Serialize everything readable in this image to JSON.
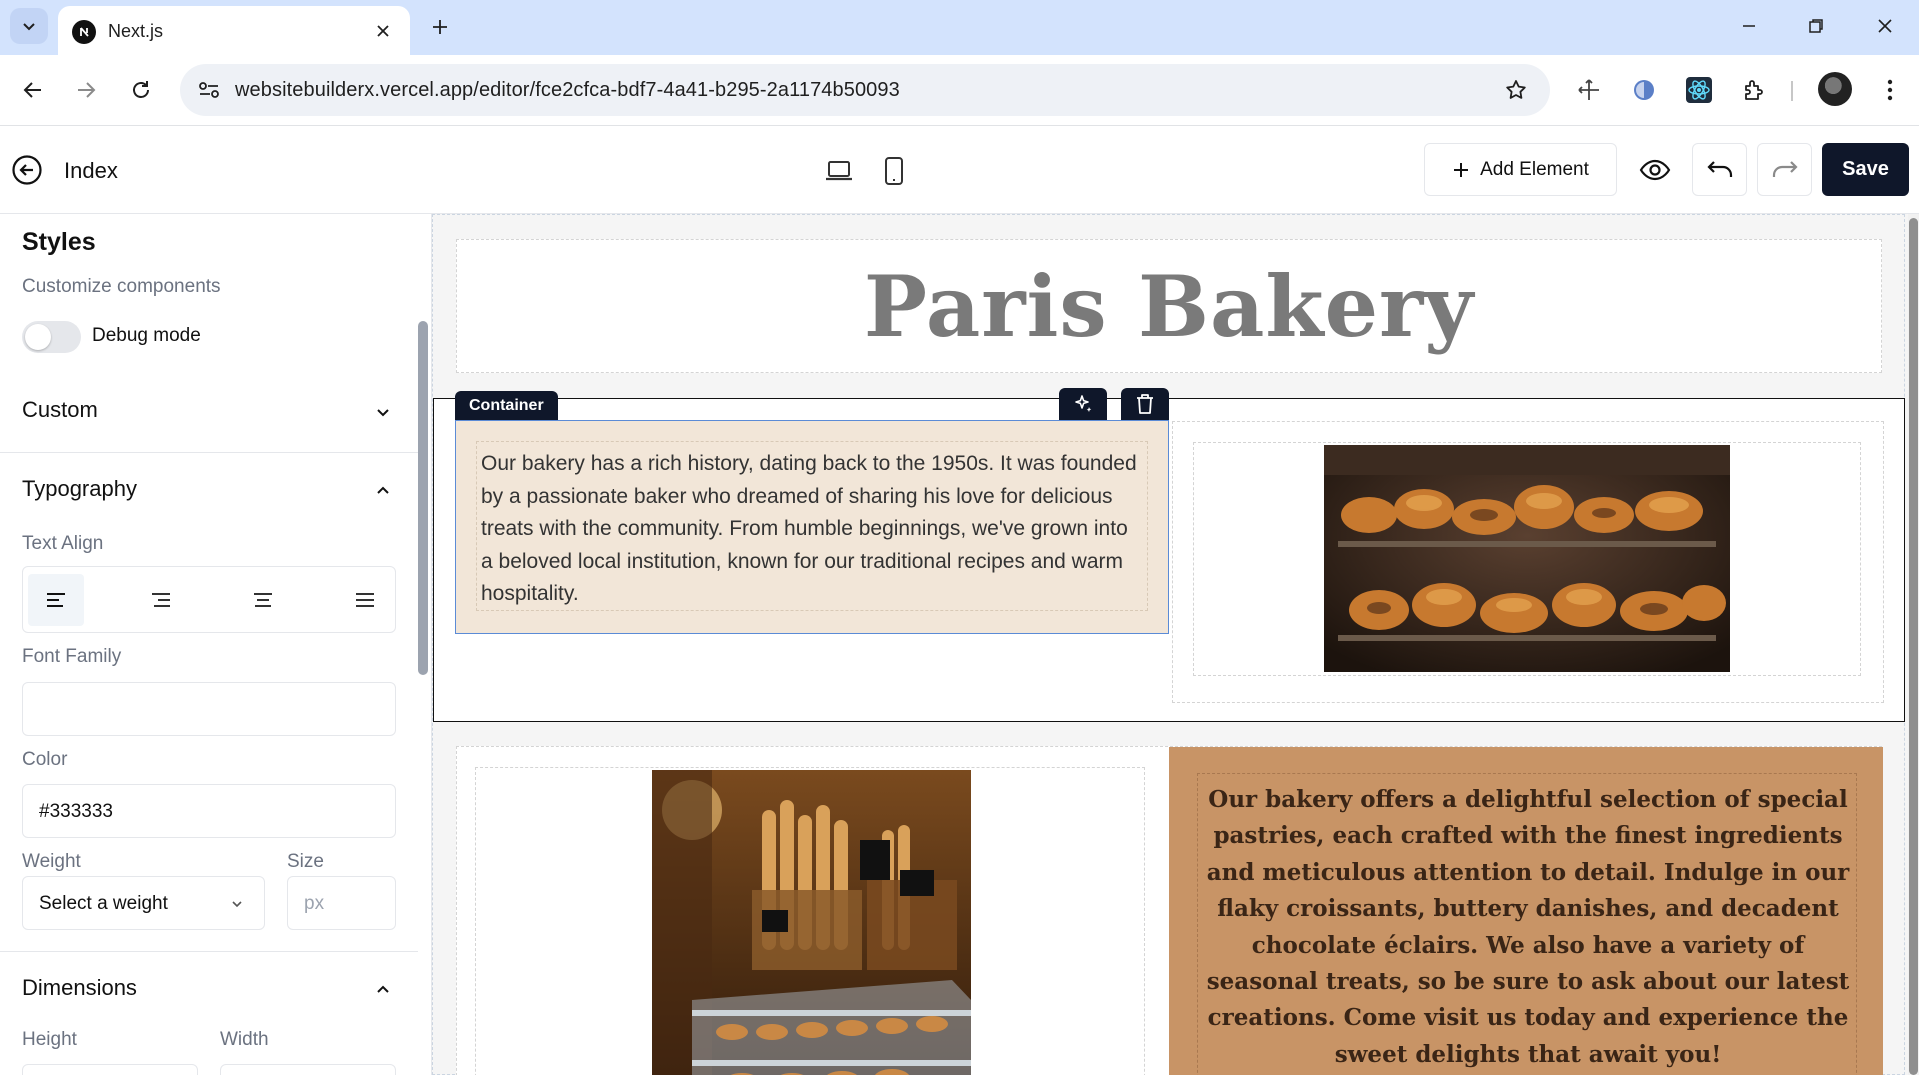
{
  "browser": {
    "tab_title": "Next.js",
    "url": "websitebuilderx.vercel.app/editor/fce2cfca-bdf7-4a41-b295-2a1174b50093",
    "icons": [
      "tab-list-icon",
      "nextjs-favicon",
      "close-icon",
      "plus-icon",
      "minimize-icon",
      "restore-icon",
      "close-window-icon",
      "back-arrow-icon",
      "forward-arrow-icon",
      "reload-icon",
      "site-info-icon",
      "bookmark-star-icon",
      "move-tool-icon",
      "extension-icon",
      "react-devtools-icon",
      "puzzle-extensions-icon",
      "profile-avatar"
    ]
  },
  "editor": {
    "page_name": "Index",
    "add_element_label": "Add Element",
    "save_label": "Save",
    "icons": [
      "back-circle-icon",
      "laptop-icon",
      "mobile-icon",
      "plus-icon",
      "eye-icon",
      "undo-icon",
      "redo-icon"
    ]
  },
  "sidebar": {
    "styles_title": "Styles",
    "styles_subtitle": "Customize components",
    "debug_label": "Debug mode",
    "debug_on": false,
    "custom_title": "Custom",
    "typography_title": "Typography",
    "text_align_label": "Text Align",
    "text_align_options": [
      "left",
      "right",
      "center",
      "justify"
    ],
    "text_align_selected": "left",
    "font_family_label": "Font Family",
    "font_family_value": "",
    "color_label": "Color",
    "color_value": "#333333",
    "weight_label": "Weight",
    "weight_placeholder": "Select a weight",
    "size_label": "Size",
    "size_placeholder": "px",
    "dimensions_title": "Dimensions",
    "height_label": "Height",
    "width_label": "Width"
  },
  "canvas": {
    "hero_title": "Paris Bakery",
    "selected_tag": "Container",
    "history_text": "Our bakery has a rich history, dating back to the 1950s. It was founded by a passionate baker who dreamed of sharing his love for delicious treats with the community. From humble beginnings, we've grown into a beloved local institution, known for our traditional recipes and warm hospitality.",
    "specials_text": "Our bakery offers a delightful selection of special pastries, each crafted with the finest ingredients and meticulous attention to detail. Indulge in our flaky croissants, buttery danishes, and decadent chocolate éclairs. We also have a variety of seasonal treats, so be sure to ask about our latest creations. Come visit us today and experience the sweet delights that await you!",
    "images": [
      "pastry-display-photo",
      "bakery-interior-photo"
    ],
    "colors": {
      "history_bg": "#f2e6d8",
      "specials_bg": "#c89466",
      "hero_title": "#7a7a7a",
      "selection": "#5b8bd6"
    }
  }
}
